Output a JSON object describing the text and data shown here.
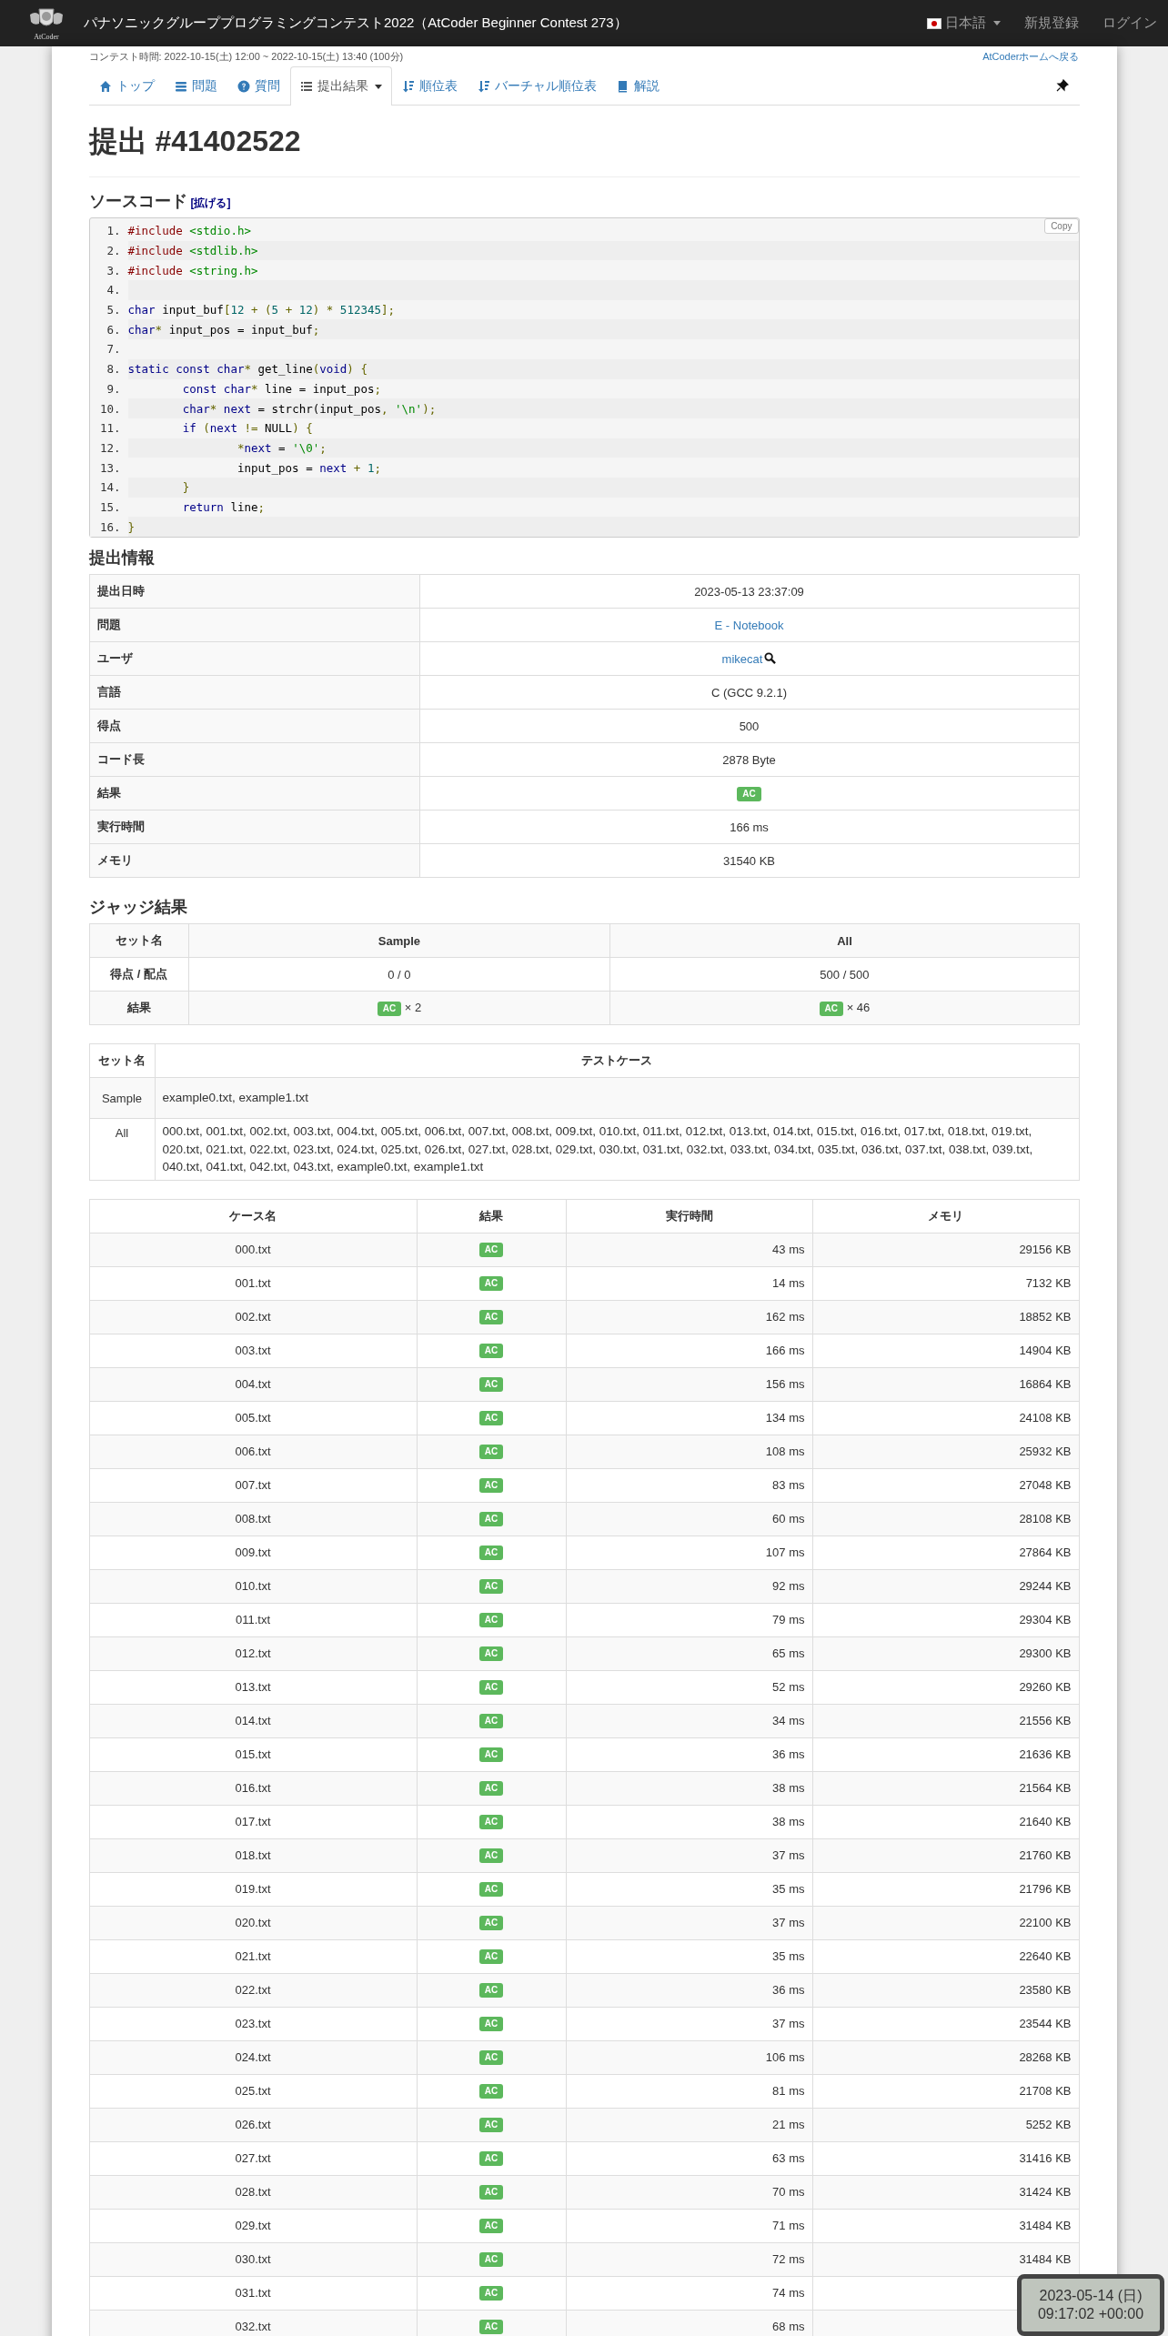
{
  "header": {
    "logo_text": "AtCoder",
    "title": "パナソニックグループプログラミングコンテスト2022（AtCoder Beginner Contest 273）",
    "language": "日本語",
    "links": [
      "新規登録",
      "ログイン"
    ]
  },
  "contest_time": "コンテスト時間: 2022-10-15(土) 12:00 ~ 2022-10-15(土) 13:40 (100分)",
  "home_link": "AtCoderホームへ戻る",
  "tabs": [
    {
      "label": "トップ",
      "selected": false,
      "dropdown": false
    },
    {
      "label": "問題",
      "selected": false,
      "dropdown": false
    },
    {
      "label": "質問",
      "selected": false,
      "dropdown": false
    },
    {
      "label": "提出結果",
      "selected": true,
      "dropdown": true
    },
    {
      "label": "順位表",
      "selected": false,
      "dropdown": false
    },
    {
      "label": "バーチャル順位表",
      "selected": false,
      "dropdown": false
    },
    {
      "label": "解説",
      "selected": false,
      "dropdown": false
    }
  ],
  "title": "提出 #41402522",
  "source": {
    "heading": "ソースコード",
    "expand": "[拡げる]",
    "copy": "Copy",
    "lines": [
      {
        "n": "1.",
        "t": [
          {
            "kind": "preprocessor",
            "s": "#include"
          },
          {
            "kind": "string",
            "s": " <stdio.h>"
          }
        ]
      },
      {
        "n": "2.",
        "t": [
          {
            "kind": "preprocessor",
            "s": "#include"
          },
          {
            "kind": "string",
            "s": " <stdlib.h>"
          }
        ]
      },
      {
        "n": "3.",
        "t": [
          {
            "kind": "preprocessor",
            "s": "#include"
          },
          {
            "kind": "string",
            "s": " <string.h>"
          }
        ]
      },
      {
        "n": "4."
      },
      {
        "n": "5.",
        "t": [
          {
            "kind": "keyword",
            "s": "char"
          },
          {
            "kind": "plain",
            "s": " input_buf"
          },
          {
            "kind": "punctuation",
            "s": "["
          },
          {
            "kind": "number",
            "s": "12"
          },
          {
            "kind": "punctuation",
            "s": " + ("
          },
          {
            "kind": "number",
            "s": "5"
          },
          {
            "kind": "punctuation",
            "s": " + "
          },
          {
            "kind": "number",
            "s": "12"
          },
          {
            "kind": "punctuation",
            "s": ") * "
          },
          {
            "kind": "number",
            "s": "512345"
          },
          {
            "kind": "punctuation",
            "s": "];"
          }
        ]
      },
      {
        "n": "6.",
        "t": [
          {
            "kind": "keyword",
            "s": "char"
          },
          {
            "kind": "punctuation",
            "s": "*"
          },
          {
            "kind": "plain",
            "s": " input_pos = input_buf"
          },
          {
            "kind": "punctuation",
            "s": ";"
          }
        ]
      },
      {
        "n": "7."
      },
      {
        "n": "8.",
        "t": [
          {
            "kind": "keyword",
            "s": "static const char"
          },
          {
            "kind": "punctuation",
            "s": "*"
          },
          {
            "kind": "plain",
            "s": " get_line"
          },
          {
            "kind": "punctuation",
            "s": "("
          },
          {
            "kind": "keyword",
            "s": "void"
          },
          {
            "kind": "punctuation",
            "s": ") {"
          }
        ]
      },
      {
        "n": "9.",
        "t": [
          {
            "kind": "keyword",
            "s": "        const char"
          },
          {
            "kind": "punctuation",
            "s": "*"
          },
          {
            "kind": "plain",
            "s": " line = input_pos"
          },
          {
            "kind": "punctuation",
            "s": ";"
          }
        ]
      },
      {
        "n": "10.",
        "t": [
          {
            "kind": "keyword",
            "s": "        char"
          },
          {
            "kind": "punctuation",
            "s": "*"
          },
          {
            "kind": "keyword",
            "s": " next"
          },
          {
            "kind": "plain",
            "s": " = strchr(input_pos"
          },
          {
            "kind": "punctuation",
            "s": ", "
          },
          {
            "kind": "string",
            "s": "'\\n'"
          },
          {
            "kind": "punctuation",
            "s": ");"
          }
        ]
      },
      {
        "n": "11.",
        "t": [
          {
            "kind": "keyword",
            "s": "        if"
          },
          {
            "kind": "punctuation",
            "s": " ("
          },
          {
            "kind": "keyword",
            "s": "next"
          },
          {
            "kind": "punctuation",
            "s": " != "
          },
          {
            "kind": "plain",
            "s": "NULL"
          },
          {
            "kind": "punctuation",
            "s": ") {"
          }
        ]
      },
      {
        "n": "12.",
        "t": [
          {
            "kind": "punctuation",
            "s": "                *"
          },
          {
            "kind": "keyword",
            "s": "next"
          },
          {
            "kind": "plain",
            "s": " = "
          },
          {
            "kind": "string",
            "s": "'\\0'"
          },
          {
            "kind": "punctuation",
            "s": ";"
          }
        ]
      },
      {
        "n": "13.",
        "t": [
          {
            "kind": "plain",
            "s": "                input_pos = "
          },
          {
            "kind": "keyword",
            "s": "next"
          },
          {
            "kind": "punctuation",
            "s": " + "
          },
          {
            "kind": "number",
            "s": "1"
          },
          {
            "kind": "punctuation",
            "s": ";"
          }
        ]
      },
      {
        "n": "14.",
        "t": [
          {
            "kind": "punctuation",
            "s": "        }"
          }
        ]
      },
      {
        "n": "15.",
        "t": [
          {
            "kind": "keyword",
            "s": "        return"
          },
          {
            "kind": "plain",
            "s": " line"
          },
          {
            "kind": "punctuation",
            "s": ";"
          }
        ]
      },
      {
        "n": "16.",
        "t": [
          {
            "kind": "punctuation",
            "s": "}"
          }
        ]
      }
    ]
  },
  "info": {
    "heading": "提出情報",
    "rows": [
      {
        "label": "提出日時",
        "kind": "text",
        "value": "2023-05-13 23:37:09"
      },
      {
        "label": "問題",
        "kind": "link",
        "value": "E - Notebook"
      },
      {
        "label": "ユーザ",
        "kind": "user",
        "value": "mikecat"
      },
      {
        "label": "言語",
        "kind": "text",
        "value": "C (GCC 9.2.1)"
      },
      {
        "label": "得点",
        "kind": "text",
        "value": "500"
      },
      {
        "label": "コード長",
        "kind": "text",
        "value": "2878 Byte"
      },
      {
        "label": "結果",
        "kind": "badge",
        "value": "AC"
      },
      {
        "label": "実行時間",
        "kind": "text",
        "value": "166 ms"
      },
      {
        "label": "メモリ",
        "kind": "text",
        "value": "31540 KB"
      }
    ]
  },
  "judge": {
    "heading": "ジャッジ結果",
    "columns": [
      "セット名",
      "Sample",
      "All"
    ],
    "rows": [
      {
        "kind": "text",
        "cells": [
          {
            "text": "得点 / 配点"
          },
          {
            "text": "0 / 0"
          },
          {
            "text": "500 / 500"
          }
        ]
      },
      {
        "kind": "result",
        "cells": [
          {
            "text": "結果"
          },
          {
            "badge": "AC",
            "text": "× 2"
          },
          {
            "badge": "AC",
            "text": "× 46"
          }
        ]
      }
    ]
  },
  "sets": {
    "columns": [
      "セット名",
      "テストケース"
    ],
    "rows": [
      {
        "name": "Sample",
        "cases": "example0.txt, example1.txt"
      },
      {
        "name": "All",
        "cases": "000.txt, 001.txt, 002.txt, 003.txt, 004.txt, 005.txt, 006.txt, 007.txt, 008.txt, 009.txt, 010.txt, 011.txt, 012.txt, 013.txt, 014.txt, 015.txt, 016.txt, 017.txt, 018.txt, 019.txt, 020.txt, 021.txt, 022.txt, 023.txt, 024.txt, 025.txt, 026.txt, 027.txt, 028.txt, 029.txt, 030.txt, 031.txt, 032.txt, 033.txt, 034.txt, 035.txt, 036.txt, 037.txt, 038.txt, 039.txt, 040.txt, 041.txt, 042.txt, 043.txt, example0.txt, example1.txt"
      }
    ]
  },
  "cases": {
    "columns": [
      "ケース名",
      "結果",
      "実行時間",
      "メモリ"
    ],
    "rows": [
      {
        "name": "000.txt",
        "status": "AC",
        "time": "43 ms",
        "memory": "29156 KB"
      },
      {
        "name": "001.txt",
        "status": "AC",
        "time": "14 ms",
        "memory": "7132 KB"
      },
      {
        "name": "002.txt",
        "status": "AC",
        "time": "162 ms",
        "memory": "18852 KB"
      },
      {
        "name": "003.txt",
        "status": "AC",
        "time": "166 ms",
        "memory": "14904 KB"
      },
      {
        "name": "004.txt",
        "status": "AC",
        "time": "156 ms",
        "memory": "16864 KB"
      },
      {
        "name": "005.txt",
        "status": "AC",
        "time": "134 ms",
        "memory": "24108 KB"
      },
      {
        "name": "006.txt",
        "status": "AC",
        "time": "108 ms",
        "memory": "25932 KB"
      },
      {
        "name": "007.txt",
        "status": "AC",
        "time": "83 ms",
        "memory": "27048 KB"
      },
      {
        "name": "008.txt",
        "status": "AC",
        "time": "60 ms",
        "memory": "28108 KB"
      },
      {
        "name": "009.txt",
        "status": "AC",
        "time": "107 ms",
        "memory": "27864 KB"
      },
      {
        "name": "010.txt",
        "status": "AC",
        "time": "92 ms",
        "memory": "29244 KB"
      },
      {
        "name": "011.txt",
        "status": "AC",
        "time": "79 ms",
        "memory": "29304 KB"
      },
      {
        "name": "012.txt",
        "status": "AC",
        "time": "65 ms",
        "memory": "29300 KB"
      },
      {
        "name": "013.txt",
        "status": "AC",
        "time": "52 ms",
        "memory": "29260 KB"
      },
      {
        "name": "014.txt",
        "status": "AC",
        "time": "34 ms",
        "memory": "21556 KB"
      },
      {
        "name": "015.txt",
        "status": "AC",
        "time": "36 ms",
        "memory": "21636 KB"
      },
      {
        "name": "016.txt",
        "status": "AC",
        "time": "38 ms",
        "memory": "21564 KB"
      },
      {
        "name": "017.txt",
        "status": "AC",
        "time": "38 ms",
        "memory": "21640 KB"
      },
      {
        "name": "018.txt",
        "status": "AC",
        "time": "37 ms",
        "memory": "21760 KB"
      },
      {
        "name": "019.txt",
        "status": "AC",
        "time": "35 ms",
        "memory": "21796 KB"
      },
      {
        "name": "020.txt",
        "status": "AC",
        "time": "37 ms",
        "memory": "22100 KB"
      },
      {
        "name": "021.txt",
        "status": "AC",
        "time": "35 ms",
        "memory": "22640 KB"
      },
      {
        "name": "022.txt",
        "status": "AC",
        "time": "36 ms",
        "memory": "23580 KB"
      },
      {
        "name": "023.txt",
        "status": "AC",
        "time": "37 ms",
        "memory": "23544 KB"
      },
      {
        "name": "024.txt",
        "status": "AC",
        "time": "106 ms",
        "memory": "28268 KB"
      },
      {
        "name": "025.txt",
        "status": "AC",
        "time": "81 ms",
        "memory": "21708 KB"
      },
      {
        "name": "026.txt",
        "status": "AC",
        "time": "21 ms",
        "memory": "5252 KB"
      },
      {
        "name": "027.txt",
        "status": "AC",
        "time": "63 ms",
        "memory": "31416 KB"
      },
      {
        "name": "028.txt",
        "status": "AC",
        "time": "70 ms",
        "memory": "31424 KB"
      },
      {
        "name": "029.txt",
        "status": "AC",
        "time": "71 ms",
        "memory": "31484 KB"
      },
      {
        "name": "030.txt",
        "status": "AC",
        "time": "72 ms",
        "memory": "31484 KB"
      },
      {
        "name": "031.txt",
        "status": "AC",
        "time": "74 ms"
      },
      {
        "name": "032.txt",
        "status": "AC",
        "time": "68 ms"
      }
    ]
  },
  "clock": {
    "date": "2023-05-14 (日)",
    "time": "09:17:02 +00:00"
  }
}
